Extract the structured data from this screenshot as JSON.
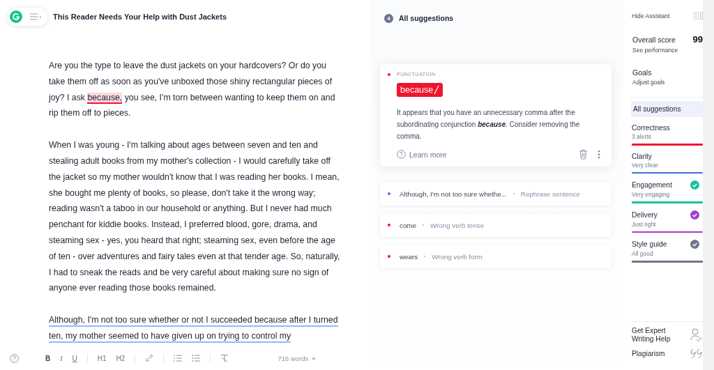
{
  "document": {
    "title": "This Reader Needs Your Help with Dust Jackets",
    "paragraphs": [
      [
        {
          "kind": "plain",
          "text": "Are you the type to leave the dust jackets on your hardcovers? Or do you take them off as soon as you've unboxed those shiny rectangular pieces of joy? I ask "
        },
        {
          "kind": "error",
          "text": "because,"
        },
        {
          "kind": "plain",
          "text": " you see, I'm torn between wanting to keep them on and rip them off to pieces."
        }
      ],
      [
        {
          "kind": "plain",
          "text": "When I was young - I'm talking about ages between seven and ten and stealing adult books from my mother's collection - I would carefully take off the jacket so my mother wouldn't know that I was reading her books. I mean, she bought me plenty of books, so please, don't take it the wrong way; reading wasn't a taboo in our household or anything. But I never had much penchant for kiddie books. Instead, I preferred blood, gore, drama, and steaming sex - yes, you heard that right; steaming sex, even before the age of ten - over adventures and fairy tales even at that tender age. So, naturally, I had to sneak the reads and be very careful about making sure no sign of anyone ever reading those books remained."
        }
      ],
      [
        {
          "kind": "clarity",
          "text": "Although, I'm not too sure whether or not I succeeded because after I turned ten, my mother seemed to have given up on trying to control my"
        }
      ]
    ]
  },
  "toolbar": {
    "buttons": [
      {
        "kind": "bold",
        "label": "B"
      },
      {
        "kind": "italic",
        "label": "I"
      },
      {
        "kind": "underline",
        "label": "U"
      },
      {
        "kind": "sep"
      },
      {
        "kind": "heading",
        "label": "H1"
      },
      {
        "kind": "heading",
        "label": "H2"
      },
      {
        "kind": "sep"
      },
      {
        "kind": "link"
      },
      {
        "kind": "sep"
      },
      {
        "kind": "numbered"
      },
      {
        "kind": "bulleted"
      },
      {
        "kind": "sep"
      },
      {
        "kind": "clear"
      }
    ],
    "word_count": "716 words"
  },
  "suggestions": {
    "count": "4",
    "title": "All suggestions",
    "expanded": {
      "category": "PUNCTUATION",
      "color": "#f0142f",
      "chip": "because",
      "description": "It appears that you have an unnecessary comma after the subordinating conjunction **because**. Consider removing the comma.",
      "learn_more": "Learn more"
    },
    "items": [
      {
        "text": "Although, I'm not too sure whethe...",
        "hint": "Rephrase sentence",
        "color": "#4a6ee0"
      },
      {
        "text": "come",
        "hint": "Wrong verb tense",
        "color": "#f0142f"
      },
      {
        "text": "wears",
        "hint": "Wrong verb form",
        "color": "#f0142f"
      }
    ]
  },
  "assistant": {
    "hide": "Hide Assistant",
    "score": {
      "label": "Overall score",
      "value": "99",
      "link": "See performance"
    },
    "goals": {
      "label": "Goals",
      "link": "Adjust goals"
    },
    "nav": [
      {
        "label": "All suggestions",
        "selected": true
      }
    ],
    "categories": [
      {
        "name": "Correctness",
        "status": "3 alerts",
        "color": "#f0142f",
        "checked": false
      },
      {
        "name": "Clarity",
        "status": "Very clear",
        "color": "#3f6ee2",
        "checked": false
      },
      {
        "name": "Engagement",
        "status": "Very engaging",
        "color": "#15c39a",
        "checked": true
      },
      {
        "name": "Delivery",
        "status": "Just right",
        "color": "#a33fd0",
        "checked": true
      },
      {
        "name": "Style guide",
        "status": "All good",
        "color": "#6d758d",
        "checked": true
      }
    ],
    "footer": [
      {
        "kind": "expert",
        "label": "Get Expert Writing Help"
      },
      {
        "kind": "plagiarism",
        "label": "Plagiarism"
      }
    ]
  }
}
